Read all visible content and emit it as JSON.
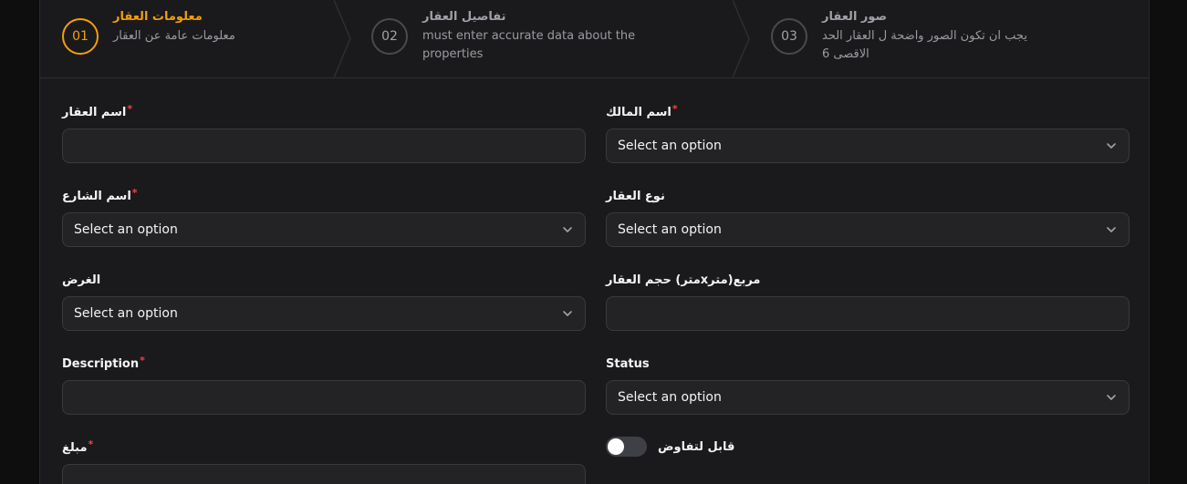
{
  "stepper": {
    "steps": [
      {
        "number": "01",
        "title": "معلومات العقار",
        "subtitle": "معلومات عامة عن العقار"
      },
      {
        "number": "02",
        "title": "تفاصيل العقار",
        "subtitle": "must enter accurate data about the properties"
      },
      {
        "number": "03",
        "title": "صور العقار",
        "subtitle": "يجب ان تكون الصور واضحة ل العقار الحد الاقصى 6"
      }
    ]
  },
  "form": {
    "property_name": {
      "label": "اسم العقار",
      "required": "*",
      "value": ""
    },
    "owner_name": {
      "label": "اسم المالك",
      "required": "*",
      "value": "Select an option"
    },
    "street_name": {
      "label": "اسم الشارع",
      "required": "*",
      "value": "Select an option"
    },
    "property_type": {
      "label": "نوع العقار",
      "value": "Select an option"
    },
    "purpose": {
      "label": "الغرض",
      "value": "Select an option"
    },
    "property_size": {
      "label": "حجم العقار (مترxمتر)مربع",
      "value": ""
    },
    "description": {
      "label": "Description",
      "required": "*",
      "value": ""
    },
    "status": {
      "label": "Status",
      "value": "Select an option"
    },
    "amount": {
      "label": "مبلغ",
      "required": "*",
      "value": ""
    },
    "negotiable": {
      "label": "قابل لتفاوض",
      "checked": false
    }
  }
}
